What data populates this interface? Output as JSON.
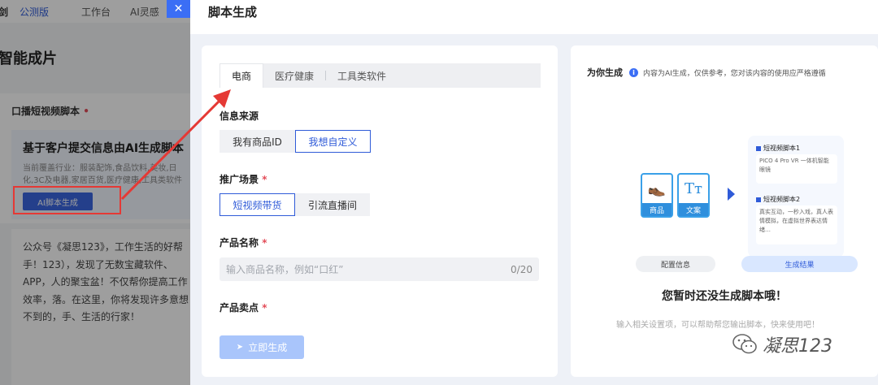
{
  "background": {
    "logo": "剑",
    "badge": "公测版",
    "nav": [
      "工作台",
      "AI灵感"
    ],
    "page_title": "智能成片",
    "section_label": "口播短视频脚本",
    "card_title": "基于客户提交信息由AI生成脚本",
    "card_desc": "当前覆盖行业：服装配饰,食品饮料,美妆,日化,3C及电器,家居百货,医疗健康,工具类软件",
    "ai_button": "AI脚本生成",
    "article": "公众号《凝思123》，工作生活的好帮手！123），发现了无数宝藏软件、APP，人的聚宝盆！不仅帮你提高工作效率，落。在这里，你将发现许多意想不到的，手、生活的行家！"
  },
  "drawer": {
    "close_icon": "close-icon",
    "title": "脚本生成"
  },
  "form": {
    "tabs": [
      "电商",
      "医疗健康",
      "工具类软件"
    ],
    "active_tab": 0,
    "source": {
      "label": "信息来源",
      "options": [
        "我有商品ID",
        "我想自定义"
      ],
      "selected": 1
    },
    "scene": {
      "label": "推广场景",
      "required_mark": "*",
      "options": [
        "短视频带货",
        "引流直播间"
      ],
      "selected": 0
    },
    "product_name": {
      "label": "产品名称",
      "required_mark": "*",
      "placeholder": "输入商品名称，例如“口红”",
      "value": "",
      "counter": "0/20"
    },
    "selling_point": {
      "label": "产品卖点",
      "required_mark": "*"
    },
    "generate_button": "立即生成"
  },
  "result": {
    "title": "为你生成",
    "notice": "内容为AI生成，仅供参考，您对该内容的使用应严格遵循",
    "illustration": {
      "product_label": "商品",
      "text_label": "文案",
      "text_glyph": "Tт",
      "script1_title": "短视频脚本1",
      "script1_text": "PICO 4 Pro VR 一体机智能眼镜",
      "script2_title": "短视频脚本2",
      "script2_text": "真实互动，一秒入戏，真人表情模拟，在虚拟世界表达情绪…",
      "config_label": "配置信息",
      "result_label": "生成结果"
    },
    "empty_title": "您暂时还没生成脚本哦！",
    "empty_hint": "输入相关设置项，可以帮助帮您输出脚本，快来使用吧！"
  },
  "watermark": "凝思123",
  "colors": {
    "accent": "#2f5bd8",
    "required": "#e34d59",
    "annotation": "#e53935",
    "disabled_button": "#a9c5fb"
  }
}
